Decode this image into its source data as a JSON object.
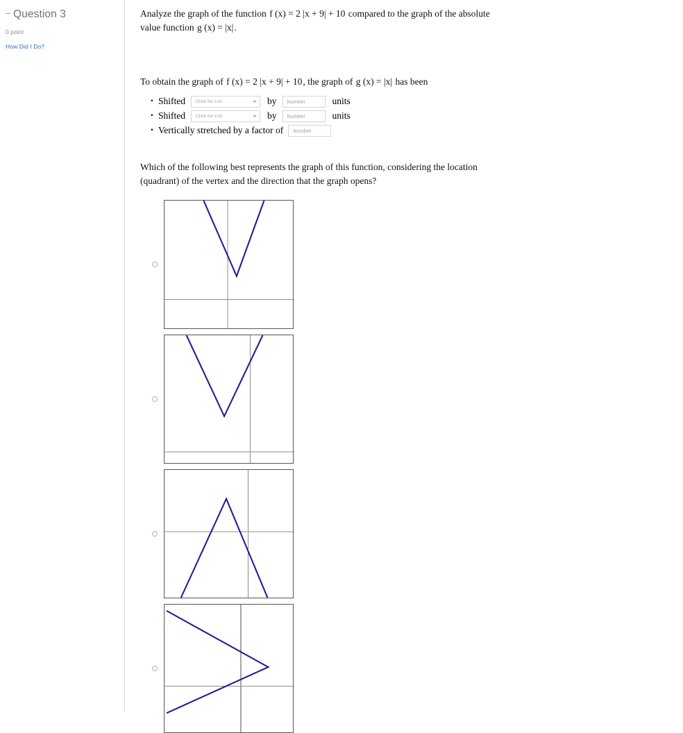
{
  "sidebar": {
    "collapse_icon": "collapse-dash-icon",
    "question_title": "Question 3",
    "points_label": "0 point",
    "how_did_i_do_label": "How Did I Do?"
  },
  "content": {
    "prompt_intro": {
      "lead": "Analyze the graph of the function",
      "function_f": "f (x) = 2 |x + 9| + 10",
      "middle": "compared to the graph of the absolute value function",
      "function_g": "g (x) = |x|",
      "period": "."
    },
    "transform_intro": {
      "lead": "To obtain the graph of",
      "function_f": "f (x) = 2 |x + 9| + 10",
      "middle": ", the graph of",
      "function_g": "g (x) = |x|",
      "trail": "has been"
    },
    "transform_items": [
      {
        "label": "Shifted",
        "select_placeholder": "Click for List",
        "by_label": "by",
        "number_placeholder": "Number",
        "units_label": "units"
      },
      {
        "label": "Shifted",
        "select_placeholder": "Click for List",
        "by_label": "by",
        "number_placeholder": "Number",
        "units_label": "units"
      },
      {
        "label": "Vertically stretched by a factor of",
        "number_placeholder": "Number"
      }
    ],
    "choice_question": "Which of the following best represents the graph of this function, considering the location (quadrant) of the vertex and the direction that the graph opens?"
  },
  "colors": {
    "curve": "#1d1d96",
    "axis": "#8d8d8d",
    "frame": "#555555",
    "link": "#2f68b5",
    "muted_text": "#8a8a8a"
  },
  "chart_data": [
    {
      "type": "line",
      "name": "option-a-graph",
      "description": "Absolute value V opening upward with vertex in quadrant I",
      "xlim": [
        -10,
        10
      ],
      "ylim": [
        -10,
        10
      ],
      "grid": false,
      "axes": {
        "x_axis_y": -4.4,
        "y_axis_x": -0.8
      },
      "vertex": [
        0.5,
        -2.6
      ],
      "opens": "up",
      "vertex_quadrant": "I",
      "x": [
        -4.2,
        0.5,
        4.5
      ],
      "y": [
        10,
        -2.6,
        10
      ]
    },
    {
      "type": "line",
      "name": "option-b-graph",
      "description": "Absolute value V opening upward with vertex in quadrant II",
      "xlim": [
        -10,
        10
      ],
      "ylim": [
        -10,
        10
      ],
      "grid": false,
      "axes": {
        "x_axis_y": -8.2,
        "y_axis_x": 3.4
      },
      "vertex": [
        -1.2,
        -4.0
      ],
      "opens": "up",
      "vertex_quadrant": "II",
      "x": [
        -6.5,
        -1.2,
        4.3
      ],
      "y": [
        10,
        -4.0,
        10
      ]
    },
    {
      "type": "line",
      "name": "option-c-graph",
      "description": "Absolute value opening downward with vertex in quadrant II",
      "xlim": [
        -10,
        10
      ],
      "ylim": [
        -10,
        10
      ],
      "grid": false,
      "axes": {
        "x_axis_y": 0.0,
        "y_axis_x": 3.1
      },
      "vertex": [
        -1.0,
        4.8
      ],
      "opens": "down",
      "vertex_quadrant": "II",
      "x": [
        -7.5,
        -1.0,
        5.6
      ],
      "y": [
        -10,
        4.8,
        -10
      ]
    },
    {
      "type": "line",
      "name": "option-d-graph",
      "description": "Sideways absolute value opening left with vertex right of the y-axis above the x-axis",
      "xlim": [
        -10,
        10
      ],
      "ylim": [
        -10,
        10
      ],
      "grid": false,
      "axes": {
        "x_axis_y": -3.2,
        "y_axis_x": 2.0
      },
      "vertex": [
        6.4,
        0.4
      ],
      "opens": "left",
      "vertex_quadrant": "I",
      "x": [
        -9.6,
        6.4,
        -9.6
      ],
      "y": [
        9.0,
        0.4,
        -9.4
      ]
    }
  ],
  "options": [
    {
      "id": "option-a",
      "selected": false
    },
    {
      "id": "option-b",
      "selected": false
    },
    {
      "id": "option-c",
      "selected": false
    },
    {
      "id": "option-d",
      "selected": false
    }
  ]
}
